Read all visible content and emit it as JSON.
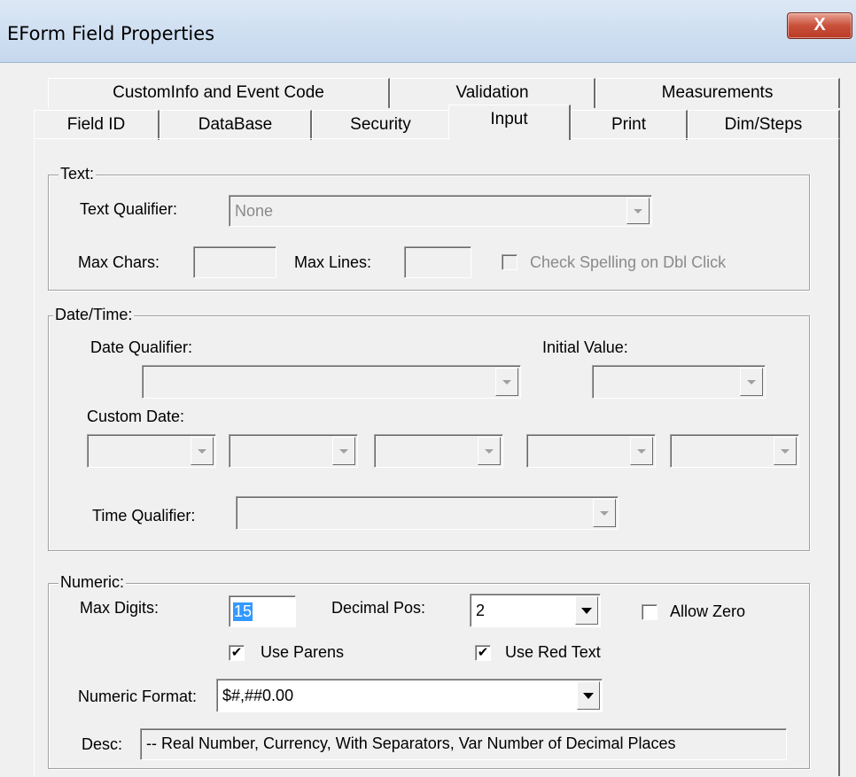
{
  "window": {
    "title": "EForm Field Properties",
    "close_glyph": "X"
  },
  "tabs_row_back": [
    "CustomInfo and Event Code",
    "Validation",
    "Measurements"
  ],
  "tabs_row_front": [
    "Field ID",
    "DataBase",
    "Security",
    "Input",
    "Print",
    "Dim/Steps"
  ],
  "active_tab": "Input",
  "text_group": {
    "legend": "Text:",
    "qualifier_label": "Text Qualifier:",
    "qualifier_value": "None",
    "max_chars_label": "Max Chars:",
    "max_lines_label": "Max Lines:",
    "spell_check_label": "Check Spelling on Dbl Click"
  },
  "datetime_group": {
    "legend": "Date/Time:",
    "date_qualifier_label": "Date Qualifier:",
    "initial_value_label": "Initial Value:",
    "custom_date_label": "Custom Date:",
    "time_qualifier_label": "Time Qualifier:"
  },
  "numeric_group": {
    "legend": "Numeric:",
    "max_digits_label": "Max Digits:",
    "max_digits_value": "15",
    "decimal_pos_label": "Decimal Pos:",
    "decimal_pos_value": "2",
    "allow_zero_label": "Allow Zero",
    "use_parens_label": "Use Parens",
    "use_red_text_label": "Use Red Text",
    "numeric_format_label": "Numeric Format:",
    "numeric_format_value": "$#,##0.00",
    "desc_label": "Desc:",
    "desc_value": "-- Real Number, Currency, With Separators, Var Number of Decimal Places"
  },
  "checks": {
    "check_glyph": "✔"
  },
  "icons": [
    "close-icon",
    "chevron-down-icon",
    "check-icon"
  ]
}
